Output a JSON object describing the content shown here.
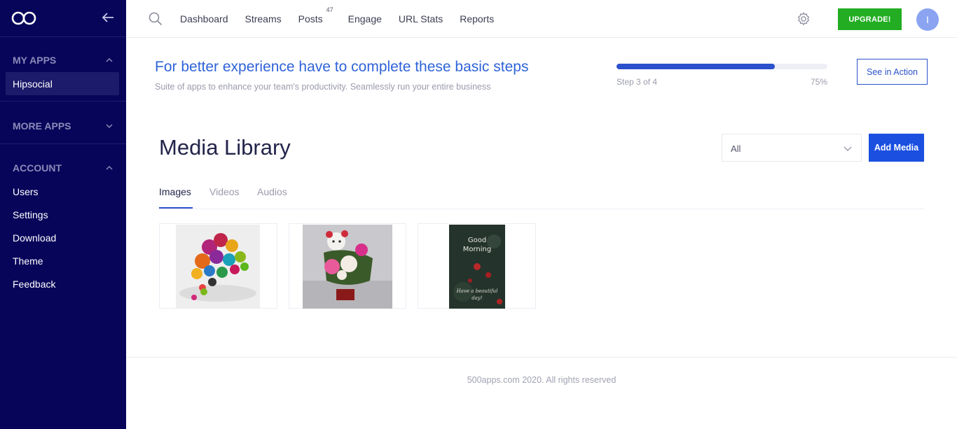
{
  "sidebar": {
    "sections": [
      {
        "title": "MY APPS",
        "chevron": "chevron-up-icon",
        "items": [
          {
            "label": "Hipsocial",
            "active": true
          }
        ]
      },
      {
        "title": "MORE APPS",
        "chevron": "chevron-down-icon",
        "items": []
      },
      {
        "title": "ACCOUNT",
        "chevron": "chevron-up-icon",
        "items": [
          {
            "label": "Users"
          },
          {
            "label": "Settings"
          },
          {
            "label": "Download"
          },
          {
            "label": "Theme"
          },
          {
            "label": "Feedback"
          }
        ]
      }
    ]
  },
  "topnav": {
    "links": [
      "Dashboard",
      "Streams",
      "Posts",
      "Engage",
      "URL Stats",
      "Reports"
    ],
    "posts_badge": "47",
    "upgrade_label": "UPGRADE!",
    "avatar_initial": "I"
  },
  "onboarding": {
    "title": "For better experience have to complete these basic steps",
    "subtitle": "Suite of apps to enhance your team's productivity. Seamlessly run your entire business",
    "step_text": "Step 3 of 4",
    "percent_text": "75%",
    "progress": 0.75,
    "cta_label": "See in Action"
  },
  "media": {
    "title": "Media Library",
    "filter_value": "All",
    "add_label": "Add Media",
    "tabs": [
      "Images",
      "Videos",
      "Audios"
    ],
    "active_tab": "Images",
    "items": [
      {
        "kind": "social-apps-bubbles"
      },
      {
        "kind": "teddy-bear-flowers"
      },
      {
        "kind": "good-morning-card",
        "text_line1": "Good",
        "text_line2": "Morning",
        "caption_line1": "Have a beautiful",
        "caption_line2": "day!"
      }
    ]
  },
  "footer": {
    "text": "500apps.com 2020. All rights reserved"
  },
  "colors": {
    "sidebar": "#07055a",
    "accent": "#2b52cc",
    "upgrade": "#22ad22",
    "add_media": "#1a4fe0"
  }
}
